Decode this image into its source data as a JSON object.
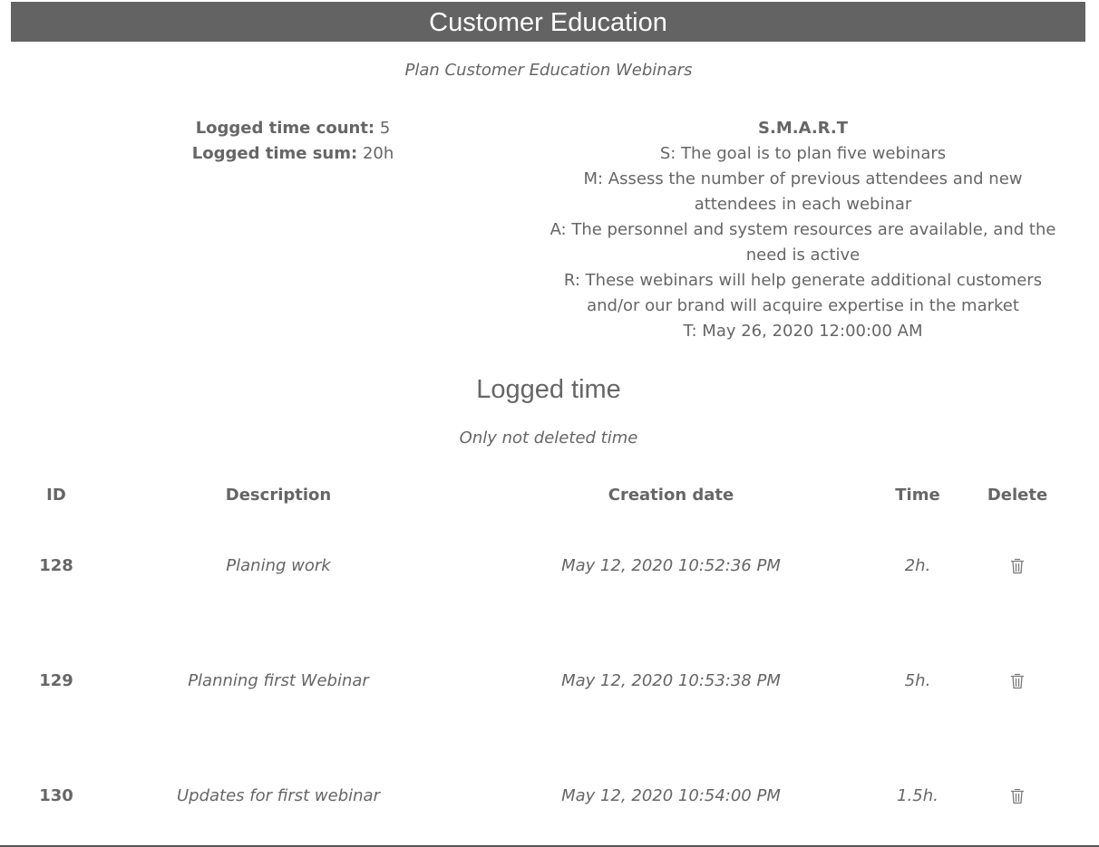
{
  "header": {
    "title": "Customer Education",
    "subtitle": "Plan Customer Education Webinars"
  },
  "stats": {
    "count_label": "Logged time count:",
    "count_value": "5",
    "sum_label": "Logged time sum:",
    "sum_value": "20h"
  },
  "smart": {
    "title": "S.M.A.R.T",
    "s": "S: The goal is to plan five webinars",
    "m": "M: Assess the number of previous attendees and new attendees in each webinar",
    "a": "A: The personnel and system resources are available, and the need is active",
    "r": "R: These webinars will help generate additional customers and/or our brand will acquire expertise in the market",
    "t": "T: May 26, 2020 12:00:00 AM"
  },
  "logged": {
    "title": "Logged time",
    "note": "Only not deleted time",
    "columns": [
      "ID",
      "Description",
      "Creation date",
      "Time",
      "Delete"
    ],
    "rows": [
      {
        "id": "128",
        "description": "Planing work",
        "date": "May 12, 2020 10:52:36 PM",
        "time": "2h."
      },
      {
        "id": "129",
        "description": "Planning first Webinar",
        "date": "May 12, 2020 10:53:38 PM",
        "time": "5h."
      },
      {
        "id": "130",
        "description": "Updates for first webinar",
        "date": "May 12, 2020 10:54:00 PM",
        "time": "1.5h."
      }
    ],
    "delete_icon": "trash-icon"
  },
  "colors": {
    "title_bar": "#636363",
    "text": "#666666"
  }
}
